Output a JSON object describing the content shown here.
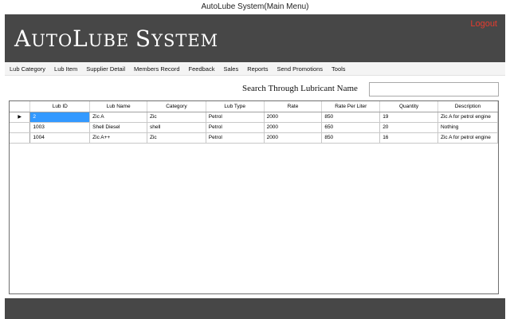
{
  "window": {
    "title": "AutoLube System(Main Menu)"
  },
  "header": {
    "brand_a": "A",
    "brand_b": "UTO",
    "brand_c": "L",
    "brand_d": "UBE ",
    "brand_e": "S",
    "brand_f": "YSTEM",
    "logout_label": "Logout"
  },
  "menu": {
    "items": [
      {
        "label": "Lub Category"
      },
      {
        "label": "Lub Item"
      },
      {
        "label": "Supplier Detail"
      },
      {
        "label": "Members Record"
      },
      {
        "label": "Feedback"
      },
      {
        "label": "Sales"
      },
      {
        "label": "Reports"
      },
      {
        "label": "Send Promotions"
      },
      {
        "label": "Tools"
      }
    ]
  },
  "search": {
    "label": "Search Through Lubricant Name",
    "value": ""
  },
  "table": {
    "columns": [
      "Lub ID",
      "Lub Name",
      "Category",
      "Lub Type",
      "Rate",
      "Rate Per Liter",
      "Quantity",
      "Description"
    ],
    "rows": [
      [
        "2",
        "Zic A",
        "Zic",
        "Petrol",
        "2000",
        "850",
        "19",
        "Zic A for petrol engine"
      ],
      [
        "1003",
        "Shell Diesel",
        "shell",
        "Petrol",
        "2000",
        "650",
        "20",
        "Nothing"
      ],
      [
        "1004",
        "Zic A++",
        "Zic",
        "Petrol",
        "2000",
        "850",
        "16",
        "Zic A for petrol engine"
      ]
    ],
    "current_row_icon": "row-pointer-icon",
    "selected_color": "#3399ff"
  },
  "colors": {
    "header_bg": "#474747",
    "logout": "#e53b2e"
  }
}
